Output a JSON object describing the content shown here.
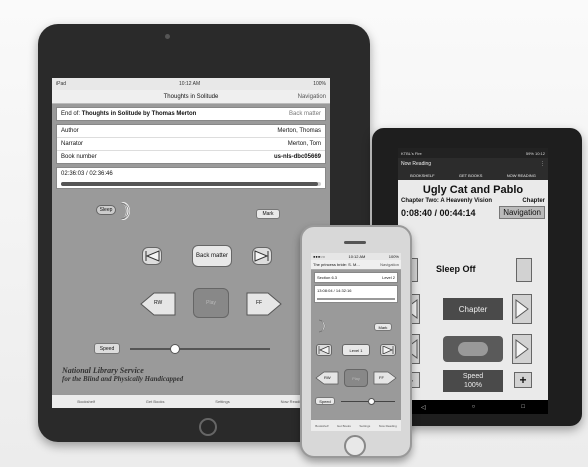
{
  "ipad": {
    "status_left": "iPad",
    "status_time": "10:12 AM",
    "status_right": "100%",
    "nav_title": "Thoughts in Solitude",
    "nav_right": "Navigation",
    "end_of_prefix": "End of:",
    "end_of_title": "Thoughts in Solitude by Thomas Merton",
    "end_of_right": "Back matter",
    "author_label": "Author",
    "author_value": "Merton, Thomas",
    "narrator_label": "Narrator",
    "narrator_value": "Merton, Tom",
    "book_number_label": "Book number",
    "book_number_value": "us-nls-dbc05669",
    "time": "02:36:03 / 02:36:46",
    "sleep_label": "Sleep",
    "mark_label": "Mark",
    "back_matter_button": "Back matter",
    "rw_label": "RW",
    "play_label": "Play",
    "ff_label": "FF",
    "speed_label": "Speed",
    "speed_fraction": 0.32,
    "progress_fraction": 0.99,
    "caption_line1": "National Library Service",
    "caption_line2": "for the Blind and Physically Handicapped",
    "tabs": [
      "Bookshelf",
      "Get Books",
      "Settings",
      "Now Reading"
    ]
  },
  "kindle": {
    "status_left": "KTBL's Fire",
    "status_right": "59% 10:12",
    "app_title": "Now Reading",
    "tabs": [
      "BOOKSHELF",
      "GET BOOKS",
      "NOW READING"
    ],
    "book_title": "Ugly Cat and Pablo",
    "chapter_title": "Chapter Two: A Heavenly Vision",
    "chapter_right": "Chapter",
    "time": "0:08:40 / 00:44:14",
    "navigation_button": "Navigation",
    "sleep_off": "Sleep Off",
    "chapter_button": "Chapter",
    "speed_line1": "Speed",
    "speed_line2": "100%",
    "minus": "-",
    "plus": "+",
    "navbar_icons": [
      "back-icon",
      "home-icon",
      "recents-icon"
    ]
  },
  "iphone": {
    "status_left": "●●●○○",
    "status_time": "10:12 AM",
    "status_right": "100%",
    "nav_title": "The princess bride: S. M...",
    "nav_right": "Navigation",
    "section_label": "Section 6.3",
    "section_right": "Level 2",
    "time": "13:08:04 / 14:32:16",
    "mark_label": "Mark",
    "level_button": "Level 1",
    "rw_label": "RW",
    "play_label": "Play",
    "ff_label": "FF",
    "speed_label": "Speed",
    "speed_fraction": 0.55,
    "tabs": [
      "Bookshelf",
      "Get Books",
      "Settings",
      "Now Reading"
    ]
  }
}
